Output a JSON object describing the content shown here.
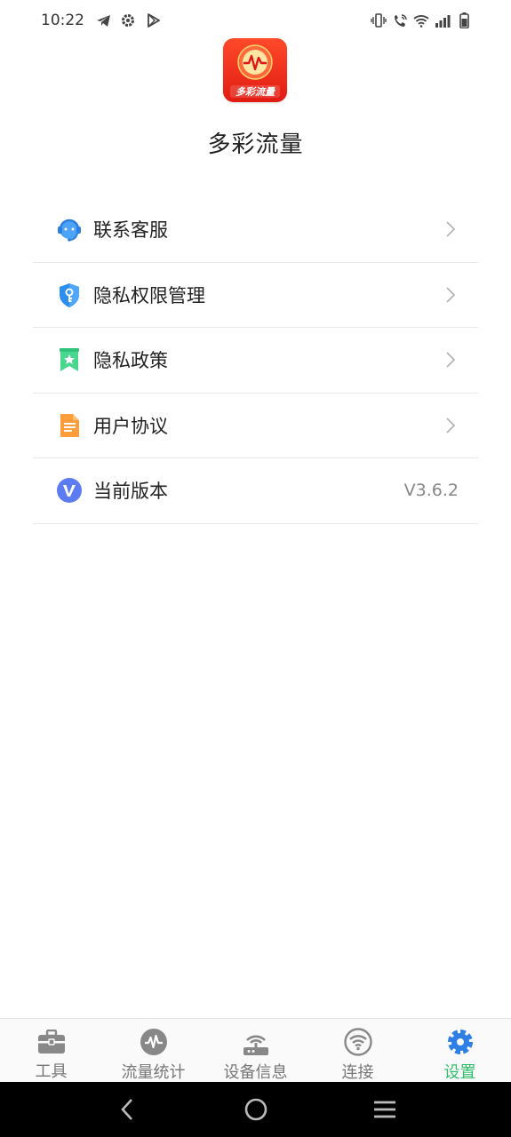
{
  "status_bar": {
    "time": "10:22",
    "left_icons": [
      "telegram-icon",
      "gear-icon",
      "play-store-icon"
    ],
    "right_icons": [
      "vibrate-icon",
      "wifi-calling-icon",
      "wifi-icon",
      "signal-icon",
      "battery-icon"
    ]
  },
  "app": {
    "name": "多彩流量",
    "logo_text": "多彩流量"
  },
  "menu": {
    "items": [
      {
        "label": "联系客服",
        "icon": "customer-service-icon"
      },
      {
        "label": "隐私权限管理",
        "icon": "privacy-shield-icon"
      },
      {
        "label": "隐私政策",
        "icon": "bookmark-star-icon"
      },
      {
        "label": "用户协议",
        "icon": "document-icon"
      },
      {
        "label": "当前版本",
        "icon": "version-v-icon",
        "value": "V3.6.2"
      }
    ]
  },
  "bottom_nav": {
    "tabs": [
      {
        "label": "工具",
        "icon": "toolbox-icon"
      },
      {
        "label": "流量统计",
        "icon": "traffic-pulse-icon"
      },
      {
        "label": "设备信息",
        "icon": "router-icon"
      },
      {
        "label": "连接",
        "icon": "wifi-circle-icon"
      },
      {
        "label": "设置",
        "icon": "settings-gear-icon",
        "active": true
      }
    ],
    "active_color": "#2fbf6a",
    "inactive_color": "#777777"
  },
  "system_nav": {
    "buttons": [
      "back-icon",
      "home-icon",
      "menu-icon"
    ]
  }
}
